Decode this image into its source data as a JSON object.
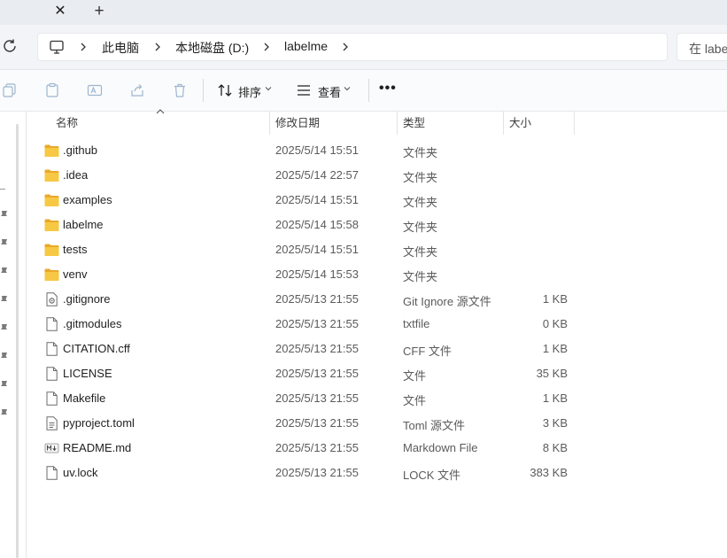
{
  "tabs": {
    "close_glyph": "✕",
    "new_glyph": "+"
  },
  "address": {
    "crumbs": [
      "此电脑",
      "本地磁盘 (D:)",
      "labelme"
    ],
    "search_placeholder": "在 labe"
  },
  "commands": {
    "sort_label": "排序",
    "view_label": "查看",
    "more_label": "•••"
  },
  "columns": {
    "name": "名称",
    "modified": "修改日期",
    "type": "类型",
    "size": "大小"
  },
  "files": [
    {
      "name": ".github",
      "modified": "2025/5/14 15:51",
      "type": "文件夹",
      "size": "",
      "icon": "folder-icon"
    },
    {
      "name": ".idea",
      "modified": "2025/5/14 22:57",
      "type": "文件夹",
      "size": "",
      "icon": "folder-icon"
    },
    {
      "name": "examples",
      "modified": "2025/5/14 15:51",
      "type": "文件夹",
      "size": "",
      "icon": "folder-icon"
    },
    {
      "name": "labelme",
      "modified": "2025/5/14 15:58",
      "type": "文件夹",
      "size": "",
      "icon": "folder-icon"
    },
    {
      "name": "tests",
      "modified": "2025/5/14 15:51",
      "type": "文件夹",
      "size": "",
      "icon": "folder-icon"
    },
    {
      "name": "venv",
      "modified": "2025/5/14 15:53",
      "type": "文件夹",
      "size": "",
      "icon": "folder-icon"
    },
    {
      "name": ".gitignore",
      "modified": "2025/5/13 21:55",
      "type": "Git Ignore 源文件",
      "size": "1 KB",
      "icon": "settings-file-icon"
    },
    {
      "name": ".gitmodules",
      "modified": "2025/5/13 21:55",
      "type": "txtfile",
      "size": "0 KB",
      "icon": "file-icon"
    },
    {
      "name": "CITATION.cff",
      "modified": "2025/5/13 21:55",
      "type": "CFF 文件",
      "size": "1 KB",
      "icon": "file-icon"
    },
    {
      "name": "LICENSE",
      "modified": "2025/5/13 21:55",
      "type": "文件",
      "size": "35 KB",
      "icon": "file-icon"
    },
    {
      "name": "Makefile",
      "modified": "2025/5/13 21:55",
      "type": "文件",
      "size": "1 KB",
      "icon": "file-icon"
    },
    {
      "name": "pyproject.toml",
      "modified": "2025/5/13 21:55",
      "type": "Toml 源文件",
      "size": "3 KB",
      "icon": "text-file-icon"
    },
    {
      "name": "README.md",
      "modified": "2025/5/13 21:55",
      "type": "Markdown File",
      "size": "8 KB",
      "icon": "markdown-file-icon"
    },
    {
      "name": "uv.lock",
      "modified": "2025/5/13 21:55",
      "type": "LOCK 文件",
      "size": "383 KB",
      "icon": "file-icon"
    }
  ],
  "colors": {
    "folder": "#f4c237",
    "accent": "#0067c0",
    "background": "#ffffff",
    "command_bar": "#fafbfc"
  }
}
